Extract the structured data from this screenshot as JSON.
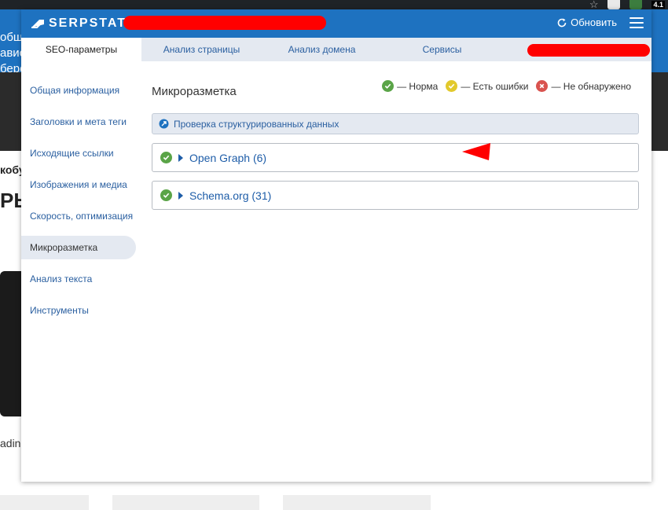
{
  "background": {
    "banner_text": [
      "общ",
      "авис",
      "бере"
    ],
    "heading_small": "кобу",
    "heading_large": "РЬ",
    "caption": "adin",
    "version_badge": "4.1"
  },
  "header": {
    "logo_text": "SERPSTAT",
    "refresh_label": "Обновить"
  },
  "tabs": [
    {
      "label": "SEO-параметры",
      "active": true
    },
    {
      "label": "Анализ страницы",
      "active": false
    },
    {
      "label": "Анализ домена",
      "active": false
    },
    {
      "label": "Сервисы",
      "active": false
    }
  ],
  "sidebar": {
    "items": [
      {
        "label": "Общая информация",
        "active": false
      },
      {
        "label": "Заголовки и мета теги",
        "active": false
      },
      {
        "label": "Исходящие ссылки",
        "active": false
      },
      {
        "label": "Изображения и медиа",
        "active": false
      },
      {
        "label": "Скорость, оптимизация",
        "active": false
      },
      {
        "label": "Микроразметка",
        "active": true
      },
      {
        "label": "Анализ текста",
        "active": false
      },
      {
        "label": "Инструменты",
        "active": false
      }
    ]
  },
  "main": {
    "title": "Микроразметка",
    "legend": {
      "ok": "— Норма",
      "warn": "— Есть ошибки",
      "none": "— Не обнаружено"
    },
    "check_link": "Проверка структурированных данных",
    "sections": [
      {
        "label": "Open Graph (6)",
        "status": "ok"
      },
      {
        "label": "Schema.org (31)",
        "status": "ok"
      }
    ]
  },
  "colors": {
    "brand_blue": "#1e72c0",
    "tab_bg": "#e4e9f1",
    "status_ok": "#5aa447",
    "status_warn": "#e2c92c",
    "status_none": "#d9534f",
    "redaction": "#ff0000"
  }
}
